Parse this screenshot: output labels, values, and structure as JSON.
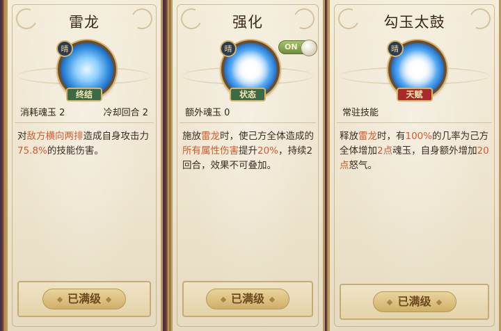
{
  "cards": [
    {
      "title": "雷龙",
      "badge_char": "晴",
      "tag_label": "终结",
      "cost_label": "消耗魂玉 2",
      "cooldown_label": "冷却回合 2",
      "desc_parts": [
        "对",
        "敌方横向两排",
        "造成自身攻击力",
        "75.8%",
        "的技能伤害。"
      ],
      "max_label": "已满级"
    },
    {
      "title": "强化",
      "toggle_label": "ON",
      "badge_char": "晴",
      "tag_label": "状态",
      "stat_label": "额外魂玉 0",
      "desc_parts": [
        "施放",
        "雷龙",
        "时，使己方全体造成的",
        "所有属性伤害",
        "提升",
        "20%",
        "，持续2回合，效果不可叠加。"
      ],
      "max_label": "已满级"
    },
    {
      "title": "勾玉太鼓",
      "badge_char": "晴",
      "tag_label": "天赋",
      "stat_label": "常驻技能",
      "desc_parts": [
        "释放",
        "雷龙",
        "时，有",
        "100%",
        "的几率为己方全体增加",
        "2点",
        "魂玉，自身额外增加",
        "20点",
        "怒气。"
      ],
      "max_label": "已满级"
    }
  ],
  "colors": {
    "highlight": "#d35a2c",
    "text": "#3b2d22",
    "toggle_on": "#6f8f3c",
    "tag_green": "#3d6a46",
    "tag_red": "#a82a2a"
  }
}
